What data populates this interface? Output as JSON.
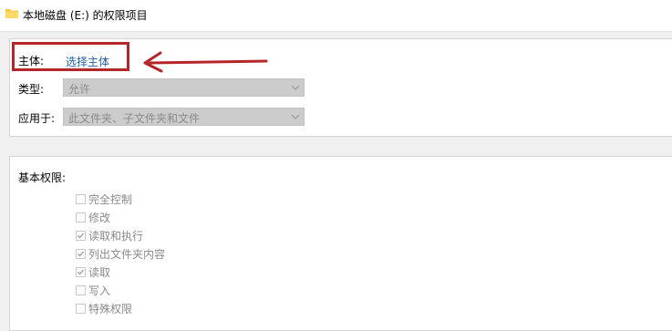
{
  "window": {
    "title": "本地磁盘 (E:) 的权限项目"
  },
  "principal": {
    "label": "主体:",
    "link_label": "选择主体"
  },
  "type": {
    "label": "类型:",
    "value": "允许"
  },
  "applies_to": {
    "label": "应用于:",
    "value": "此文件夹、子文件夹和文件"
  },
  "basic_permissions": {
    "heading": "基本权限:",
    "items": [
      {
        "label": "完全控制",
        "checked": false
      },
      {
        "label": "修改",
        "checked": false
      },
      {
        "label": "读取和执行",
        "checked": true
      },
      {
        "label": "列出文件夹内容",
        "checked": true
      },
      {
        "label": "读取",
        "checked": true
      },
      {
        "label": "写入",
        "checked": false
      },
      {
        "label": "特殊权限",
        "checked": false
      }
    ]
  },
  "annotation": {
    "highlight_color": "#b4262a"
  },
  "icons": {
    "title": "folder-icon",
    "dropdown": "chevron-down-icon",
    "annotation": "arrow-left-icon"
  }
}
